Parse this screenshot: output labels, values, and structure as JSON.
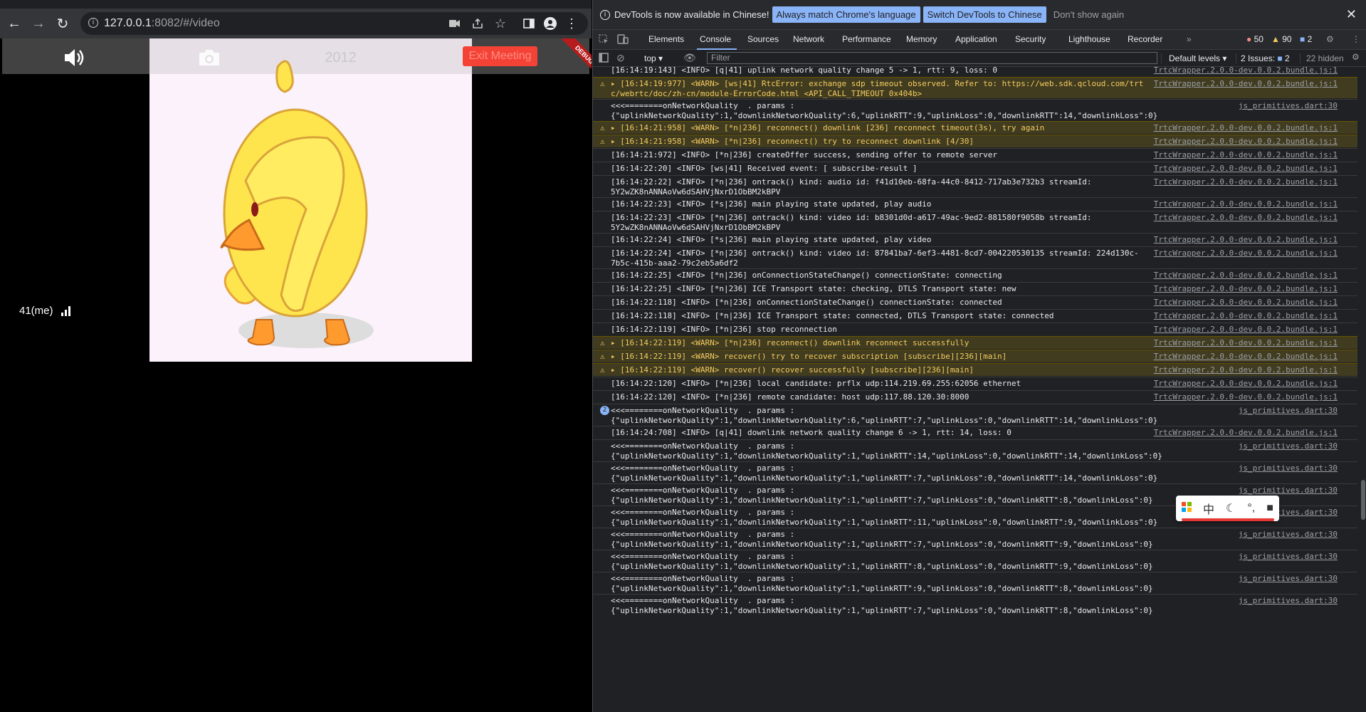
{
  "browser": {
    "url_host": "127.0.0.1",
    "url_rest": ":8082/#/video"
  },
  "app": {
    "title": "2012",
    "exit_label": "Exit Meeting",
    "debug_label": "DEBUG",
    "self_name": "41(me)"
  },
  "devtools": {
    "info": {
      "message": "DevTools is now available in Chinese!",
      "btn_match": "Always match Chrome's language",
      "btn_switch": "Switch DevTools to Chinese",
      "btn_dismiss": "Don't show again"
    },
    "tabs": [
      "Elements",
      "Console",
      "Sources",
      "Network",
      "Performance",
      "Memory",
      "Application",
      "Security",
      "Lighthouse",
      "Recorder"
    ],
    "counts": {
      "errors": "50",
      "warnings": "90",
      "messages": "2"
    },
    "context": "top",
    "filter_placeholder": "Filter",
    "levels": "Default levels",
    "issues": "2 Issues:",
    "issues_count": "2",
    "hidden": "22 hidden",
    "log": [
      {
        "t": "info",
        "msg": "[16:14:19:143] <INFO> [q|41] uplink network quality change 5 -> 1, rtt: 9, loss: 0",
        "src": "TrtcWrapper.2.0.0-dev.0.0.2.bundle.js:1"
      },
      {
        "t": "warn",
        "msg": "[16:14:19:977] <WARN> [ws|41] RtcError: exchange sdp timeout observed. Refer to: https://web.sdk.qcloud.com/trt\nc/webrtc/doc/zh-cn/module-ErrorCode.html <API_CALL_TIMEOUT 0x404b>",
        "src": "TrtcWrapper.2.0.0-dev.0.0.2.bundle.js:1"
      },
      {
        "t": "info",
        "msg": "<<<========onNetworkQuality  . params :\n{\"uplinkNetworkQuality\":1,\"downlinkNetworkQuality\":6,\"uplinkRTT\":9,\"uplinkLoss\":0,\"downlinkRTT\":14,\"downlinkLoss\":0}",
        "src": "js_primitives.dart:30"
      },
      {
        "t": "warn",
        "msg": "[16:14:21:958] <WARN> [*n|236] reconnect() downlink [236] reconnect timeout(3s), try again",
        "src": "TrtcWrapper.2.0.0-dev.0.0.2.bundle.js:1"
      },
      {
        "t": "warn",
        "msg": "[16:14:21:958] <WARN> [*n|236] reconnect() try to reconnect downlink [4/30]",
        "src": "TrtcWrapper.2.0.0-dev.0.0.2.bundle.js:1"
      },
      {
        "t": "info",
        "msg": "[16:14:21:972] <INFO> [*n|236] createOffer success, sending offer to remote server",
        "src": "TrtcWrapper.2.0.0-dev.0.0.2.bundle.js:1"
      },
      {
        "t": "info",
        "msg": "[16:14:22:20] <INFO> [ws|41] Received event: [ subscribe-result ]",
        "src": "TrtcWrapper.2.0.0-dev.0.0.2.bundle.js:1"
      },
      {
        "t": "info",
        "msg": "[16:14:22:22] <INFO> [*n|236] ontrack() kind: audio id: f41d10eb-68fa-44c0-8412-717ab3e732b3 streamId:\n5Y2wZK8nANNAoVw6dSAHVjNxrD1ObBM2kBPV",
        "src": "TrtcWrapper.2.0.0-dev.0.0.2.bundle.js:1"
      },
      {
        "t": "info",
        "msg": "[16:14:22:23] <INFO> [*s|236] main playing state updated, play audio",
        "src": "TrtcWrapper.2.0.0-dev.0.0.2.bundle.js:1"
      },
      {
        "t": "info",
        "msg": "[16:14:22:23] <INFO> [*n|236] ontrack() kind: video id: b8301d0d-a617-49ac-9ed2-881580f9058b streamId:\n5Y2wZK8nANNAoVw6dSAHVjNxrD1ObBM2kBPV",
        "src": "TrtcWrapper.2.0.0-dev.0.0.2.bundle.js:1"
      },
      {
        "t": "info",
        "msg": "[16:14:22:24] <INFO> [*s|236] main playing state updated, play video",
        "src": "TrtcWrapper.2.0.0-dev.0.0.2.bundle.js:1"
      },
      {
        "t": "info",
        "msg": "[16:14:22:24] <INFO> [*n|236] ontrack() kind: video id: 87841ba7-6ef3-4481-8cd7-004220530135 streamId: 224d130c-\n7b5c-415b-aaa2-79c2eb5a6df2",
        "src": "TrtcWrapper.2.0.0-dev.0.0.2.bundle.js:1"
      },
      {
        "t": "info",
        "msg": "[16:14:22:25] <INFO> [*n|236] onConnectionStateChange() connectionState: connecting",
        "src": "TrtcWrapper.2.0.0-dev.0.0.2.bundle.js:1"
      },
      {
        "t": "info",
        "msg": "[16:14:22:25] <INFO> [*n|236] ICE Transport state: checking, DTLS Transport state: new",
        "src": "TrtcWrapper.2.0.0-dev.0.0.2.bundle.js:1"
      },
      {
        "t": "info",
        "msg": "[16:14:22:118] <INFO> [*n|236] onConnectionStateChange() connectionState: connected",
        "src": "TrtcWrapper.2.0.0-dev.0.0.2.bundle.js:1"
      },
      {
        "t": "info",
        "msg": "[16:14:22:118] <INFO> [*n|236] ICE Transport state: connected, DTLS Transport state: connected",
        "src": "TrtcWrapper.2.0.0-dev.0.0.2.bundle.js:1"
      },
      {
        "t": "info",
        "msg": "[16:14:22:119] <INFO> [*n|236] stop reconnection",
        "src": "TrtcWrapper.2.0.0-dev.0.0.2.bundle.js:1"
      },
      {
        "t": "warn",
        "msg": "[16:14:22:119] <WARN> [*n|236] reconnect() downlink reconnect successfully",
        "src": "TrtcWrapper.2.0.0-dev.0.0.2.bundle.js:1"
      },
      {
        "t": "warn",
        "msg": "[16:14:22:119] <WARN> recover() try to recover subscription [subscribe][236][main]",
        "src": "TrtcWrapper.2.0.0-dev.0.0.2.bundle.js:1"
      },
      {
        "t": "warn",
        "msg": "[16:14:22:119] <WARN> recover() recover successfully [subscribe][236][main]",
        "src": "TrtcWrapper.2.0.0-dev.0.0.2.bundle.js:1"
      },
      {
        "t": "info",
        "msg": "[16:14:22:120] <INFO> [*n|236] local candidate: prflx udp:114.219.69.255:62056 ethernet",
        "src": "TrtcWrapper.2.0.0-dev.0.0.2.bundle.js:1"
      },
      {
        "t": "info",
        "msg": "[16:14:22:120] <INFO> [*n|236] remote candidate: host udp:117.88.120.30:8000",
        "src": "TrtcWrapper.2.0.0-dev.0.0.2.bundle.js:1"
      },
      {
        "t": "repeat",
        "count": "2",
        "msg": "<<<========onNetworkQuality  . params :\n{\"uplinkNetworkQuality\":1,\"downlinkNetworkQuality\":6,\"uplinkRTT\":7,\"uplinkLoss\":0,\"downlinkRTT\":14,\"downlinkLoss\":0}",
        "src": "js_primitives.dart:30"
      },
      {
        "t": "info",
        "msg": "[16:14:24:708] <INFO> [q|41] downlink network quality change 6 -> 1, rtt: 14, loss: 0",
        "src": "TrtcWrapper.2.0.0-dev.0.0.2.bundle.js:1"
      },
      {
        "t": "info",
        "msg": "<<<========onNetworkQuality  . params :\n{\"uplinkNetworkQuality\":1,\"downlinkNetworkQuality\":1,\"uplinkRTT\":14,\"uplinkLoss\":0,\"downlinkRTT\":14,\"downlinkLoss\":0}",
        "src": "js_primitives.dart:30"
      },
      {
        "t": "info",
        "msg": "<<<========onNetworkQuality  . params :\n{\"uplinkNetworkQuality\":1,\"downlinkNetworkQuality\":1,\"uplinkRTT\":7,\"uplinkLoss\":0,\"downlinkRTT\":14,\"downlinkLoss\":0}",
        "src": "js_primitives.dart:30"
      },
      {
        "t": "info",
        "msg": "<<<========onNetworkQuality  . params :\n{\"uplinkNetworkQuality\":1,\"downlinkNetworkQuality\":1,\"uplinkRTT\":7,\"uplinkLoss\":0,\"downlinkRTT\":8,\"downlinkLoss\":0}",
        "src": "js_primitives.dart:30"
      },
      {
        "t": "info",
        "msg": "<<<========onNetworkQuality  . params :\n{\"uplinkNetworkQuality\":1,\"downlinkNetworkQuality\":1,\"uplinkRTT\":11,\"uplinkLoss\":0,\"downlinkRTT\":9,\"downlinkLoss\":0}",
        "src": "js_primitives.dart:30"
      },
      {
        "t": "info",
        "msg": "<<<========onNetworkQuality  . params :\n{\"uplinkNetworkQuality\":1,\"downlinkNetworkQuality\":1,\"uplinkRTT\":7,\"uplinkLoss\":0,\"downlinkRTT\":9,\"downlinkLoss\":0}",
        "src": "js_primitives.dart:30"
      },
      {
        "t": "info",
        "msg": "<<<========onNetworkQuality  . params :\n{\"uplinkNetworkQuality\":1,\"downlinkNetworkQuality\":1,\"uplinkRTT\":8,\"uplinkLoss\":0,\"downlinkRTT\":9,\"downlinkLoss\":0}",
        "src": "js_primitives.dart:30"
      },
      {
        "t": "info",
        "msg": "<<<========onNetworkQuality  . params :\n{\"uplinkNetworkQuality\":1,\"downlinkNetworkQuality\":1,\"uplinkRTT\":9,\"uplinkLoss\":0,\"downlinkRTT\":8,\"downlinkLoss\":0}",
        "src": "js_primitives.dart:30"
      },
      {
        "t": "info",
        "msg": "<<<========onNetworkQuality  . params :\n{\"uplinkNetworkQuality\":1,\"downlinkNetworkQuality\":1,\"uplinkRTT\":7,\"uplinkLoss\":0,\"downlinkRTT\":8,\"downlinkLoss\":0}",
        "src": "js_primitives.dart:30"
      }
    ]
  },
  "ime": {
    "mode": "中"
  }
}
